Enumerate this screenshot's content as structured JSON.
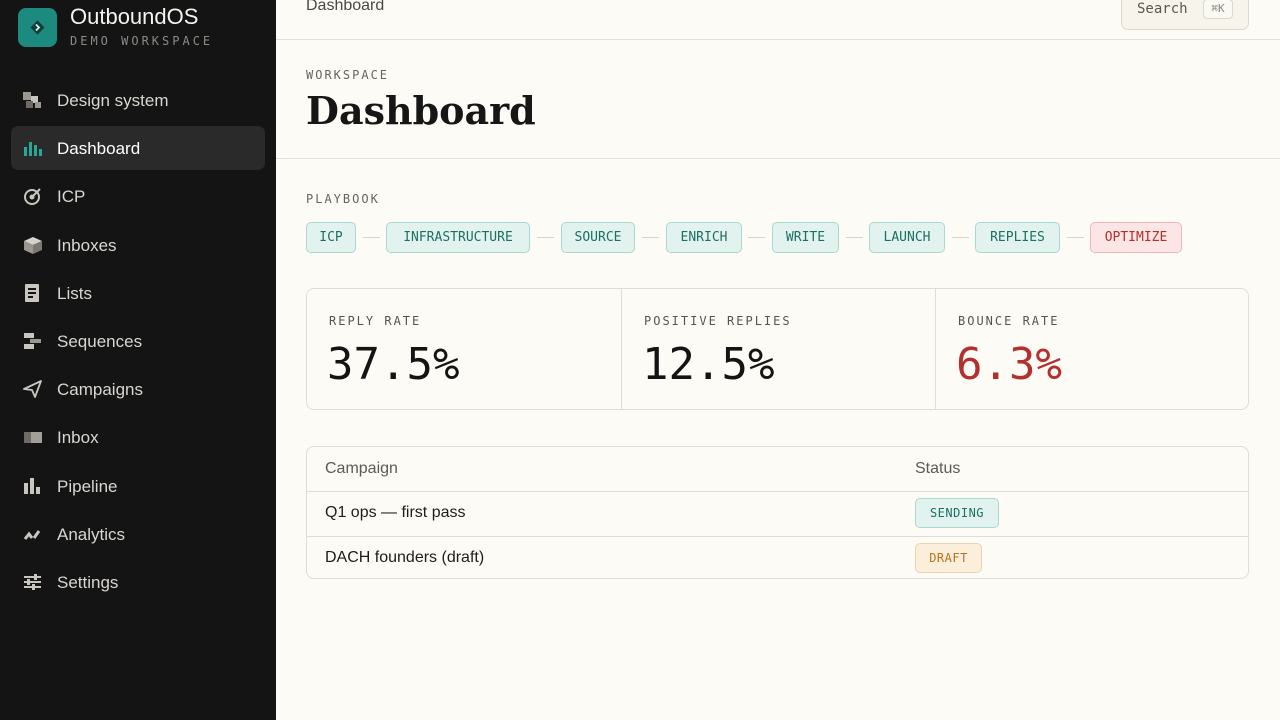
{
  "brand": {
    "name": "OutboundOS",
    "workspace": "DEMO WORKSPACE",
    "logo_icon": "diamond-arrow-icon",
    "accent": "#1c8a7e"
  },
  "sidebar": {
    "items": [
      {
        "label": "Design system",
        "icon": "design-system-icon",
        "active": false
      },
      {
        "label": "Dashboard",
        "icon": "bar-chart-icon",
        "active": true
      },
      {
        "label": "ICP",
        "icon": "target-icon",
        "active": false
      },
      {
        "label": "Inboxes",
        "icon": "box-icon",
        "active": false
      },
      {
        "label": "Lists",
        "icon": "document-list-icon",
        "active": false
      },
      {
        "label": "Sequences",
        "icon": "sequence-icon",
        "active": false
      },
      {
        "label": "Campaigns",
        "icon": "paper-plane-icon",
        "active": false
      },
      {
        "label": "Inbox",
        "icon": "inbox-tray-icon",
        "active": false
      },
      {
        "label": "Pipeline",
        "icon": "pipeline-bars-icon",
        "active": false
      },
      {
        "label": "Analytics",
        "icon": "analytics-icon",
        "active": false
      },
      {
        "label": "Settings",
        "icon": "sliders-icon",
        "active": false
      }
    ]
  },
  "topbar": {
    "title": "Dashboard",
    "search_label": "Search",
    "search_shortcut": "⌘K"
  },
  "header": {
    "eyebrow": "WORKSPACE",
    "title": "Dashboard"
  },
  "playbook": {
    "label": "PLAYBOOK",
    "stages": [
      "ICP",
      "INFRASTRUCTURE",
      "SOURCE",
      "ENRICH",
      "WRITE",
      "LAUNCH",
      "REPLIES",
      "OPTIMIZE"
    ]
  },
  "metrics": [
    {
      "label": "REPLY RATE",
      "value": "37.5%"
    },
    {
      "label": "POSITIVE REPLIES",
      "value": "12.5%"
    },
    {
      "label": "BOUNCE RATE",
      "value": "6.3%"
    }
  ],
  "campaigns": {
    "columns": [
      "Campaign",
      "Status"
    ],
    "rows": [
      {
        "name": "Q1 ops — first pass",
        "status": "SENDING"
      },
      {
        "name": "DACH founders (draft)",
        "status": "DRAFT"
      }
    ]
  },
  "colors": {
    "teal": "#1d6f63",
    "danger": "#b3302c",
    "draft": "#b8731e",
    "sidebar_bg": "#141414"
  }
}
